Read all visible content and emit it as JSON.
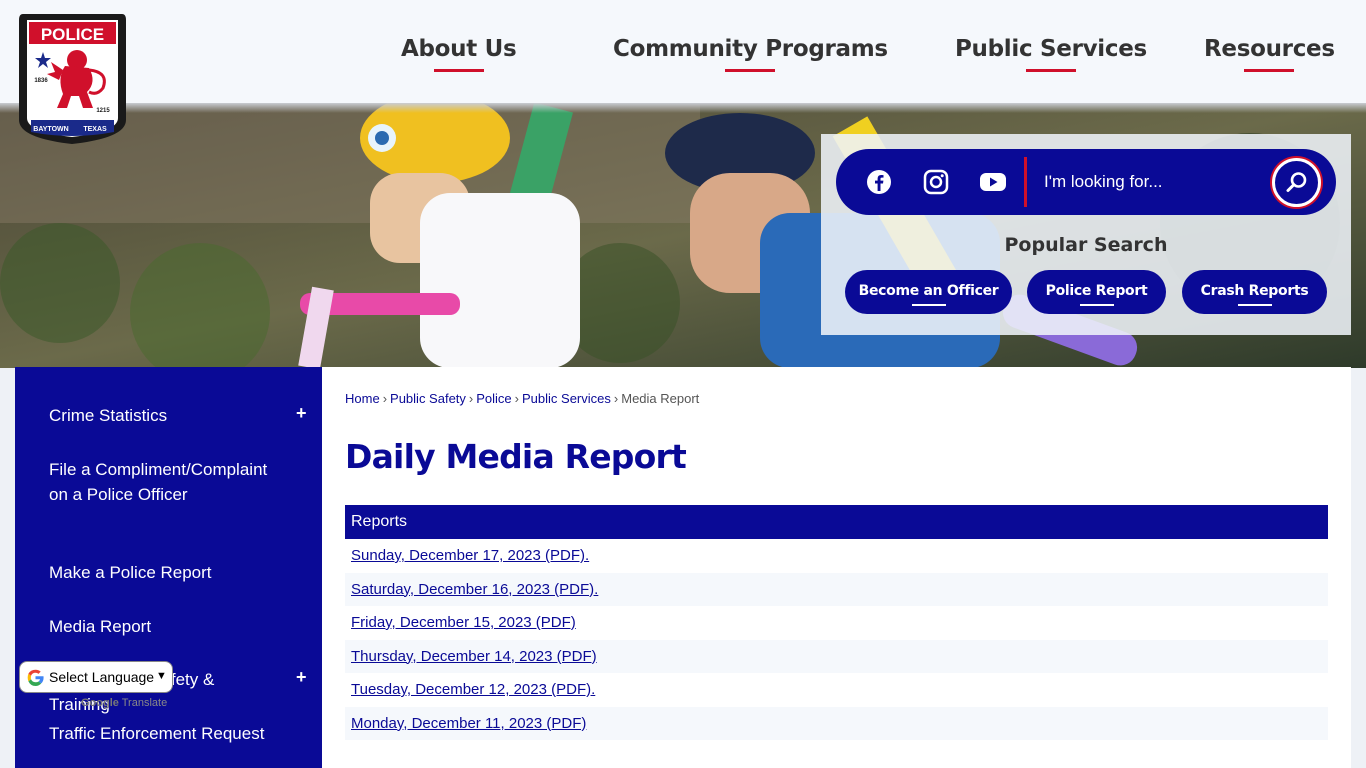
{
  "logo": {
    "top_text": "POLICE",
    "year_left": "1836",
    "year_right": "1215",
    "bottom_left": "BAYTOWN",
    "bottom_right": "TEXAS"
  },
  "nav": [
    {
      "label": "About Us"
    },
    {
      "label": "Community Programs"
    },
    {
      "label": "Public Services"
    },
    {
      "label": "Resources"
    }
  ],
  "search": {
    "placeholder": "I'm looking for...",
    "social": [
      "facebook-icon",
      "instagram-icon",
      "youtube-icon"
    ],
    "popular_title": "Popular Search",
    "popular": [
      {
        "label": "Become an Officer"
      },
      {
        "label": "Police Report"
      },
      {
        "label": "Crash Reports"
      }
    ]
  },
  "sidebar": {
    "items": [
      {
        "label": "Crime Statistics",
        "expandable": true
      },
      {
        "label": "File a Compliment/Complaint on a Police Officer",
        "expandable": false
      },
      {
        "label": "Make a Police Report",
        "expandable": false
      },
      {
        "label": "Media Report",
        "expandable": false
      },
      {
        "label": "Recruitment, Safety & Training",
        "expandable": true
      },
      {
        "label": "Traffic Enforcement Request",
        "expandable": false
      }
    ]
  },
  "translate": {
    "label": "Select Language",
    "powered_google": "Google",
    "powered_translate": "Translate"
  },
  "breadcrumb": [
    "Home",
    "Public Safety",
    "Police",
    "Public Services",
    "Media Report"
  ],
  "main": {
    "title": "Daily Media Report",
    "table_header": "Reports",
    "reports": [
      "Sunday, December 17, 2023 (PDF).",
      "Saturday, December 16, 2023 (PDF).",
      "Friday, December 15, 2023 (PDF)",
      "Thursday, December 14, 2023 (PDF)",
      "Tuesday, December 12, 2023 (PDF).",
      "Monday, December 11, 2023 (PDF)"
    ]
  },
  "colors": {
    "primary": "#0a0a96",
    "accent": "#d0102b",
    "header_bg": "#f5f8fc"
  }
}
